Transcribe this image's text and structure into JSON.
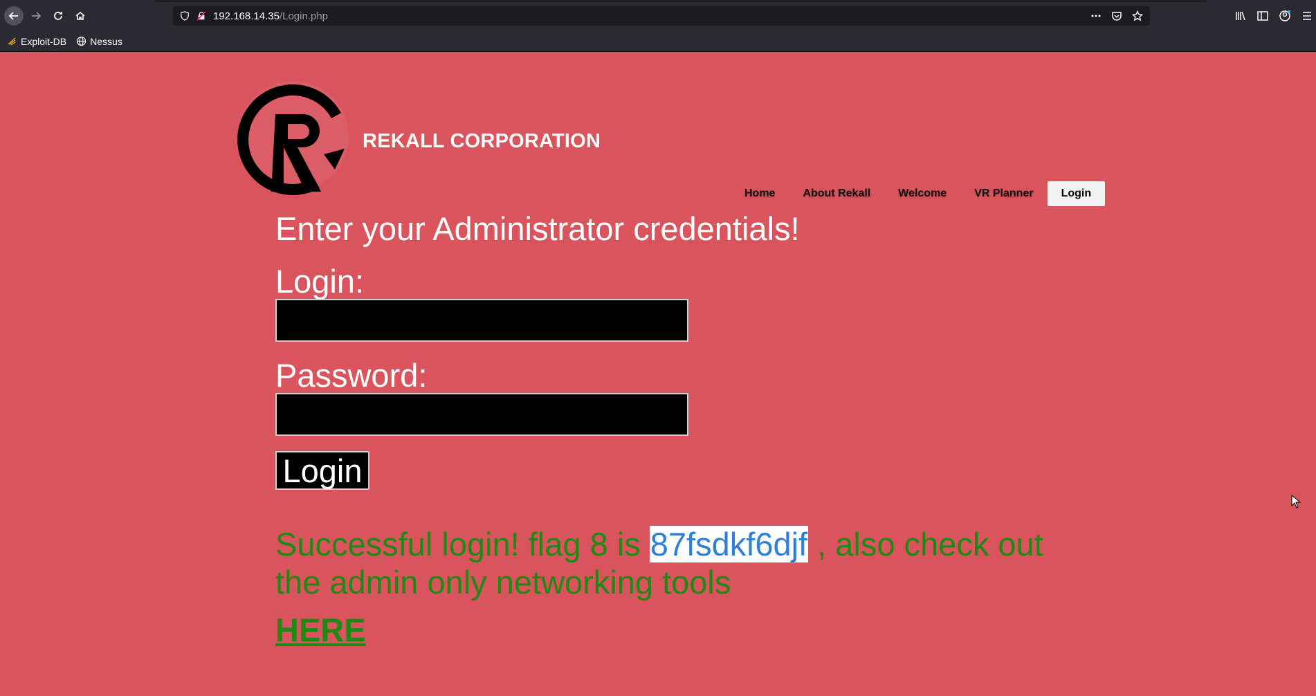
{
  "browser": {
    "url_host": "192.168.14.35",
    "url_path": "/Login.php",
    "bookmarks": [
      {
        "label": "Exploit-DB",
        "icon": "exploit-db-icon"
      },
      {
        "label": "Nessus",
        "icon": "globe-icon"
      }
    ]
  },
  "site": {
    "brand": "REKALL CORPORATION",
    "logo": "rekall-r-logo",
    "nav": [
      {
        "label": "Home"
      },
      {
        "label": "About Rekall"
      },
      {
        "label": "Welcome"
      },
      {
        "label": "VR Planner"
      },
      {
        "label": "Login",
        "active": true
      }
    ]
  },
  "form": {
    "heading": "Enter your Administrator credentials!",
    "login_label": "Login:",
    "login_value": "",
    "password_label": "Password:",
    "password_value": "",
    "submit_label": "Login"
  },
  "result": {
    "prefix": "Successful login! flag 8 is ",
    "flag": "87fsdkf6djf",
    "suffix": " , also check out the admin only networking tools",
    "link_label": "HERE"
  },
  "colors": {
    "page_background": "#d9545c",
    "success_text": "#1e8a14",
    "flag_highlight_text": "#2f7fd6"
  }
}
